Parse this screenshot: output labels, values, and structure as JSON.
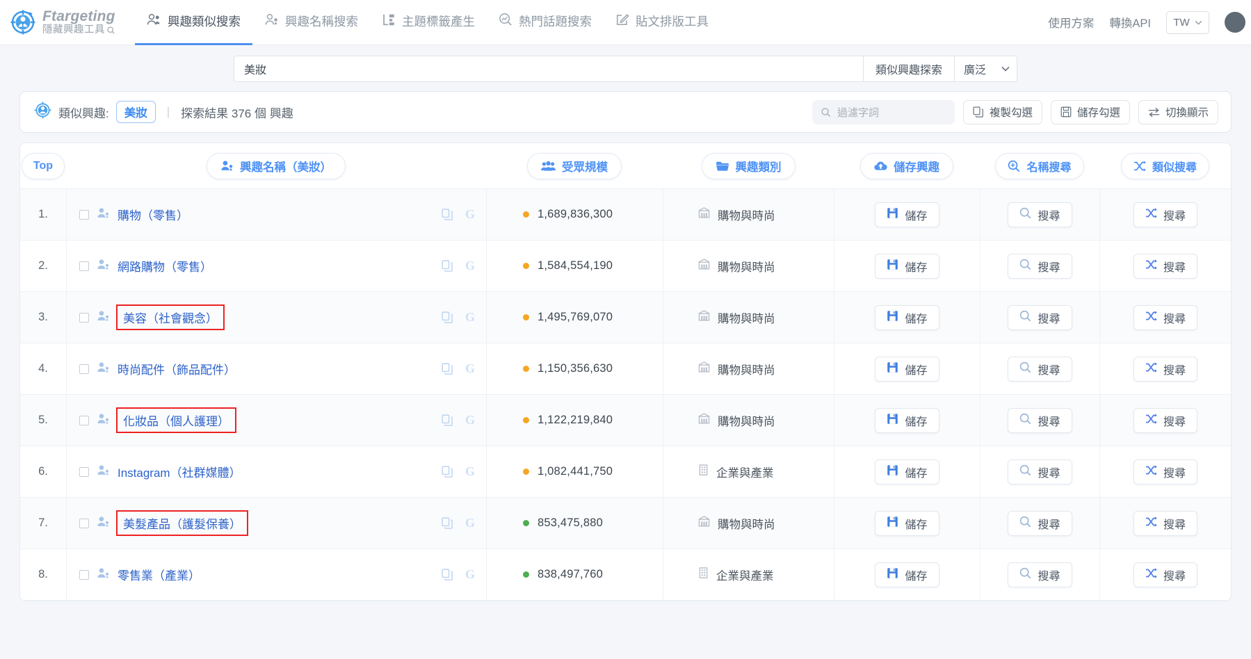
{
  "brand": {
    "name": "Ftargeting",
    "subtitle": "隱藏興趣工具",
    "sub_icon": "magnifier-icon"
  },
  "nav": {
    "items": [
      {
        "label": "興趣類似搜索",
        "icon": "users-search-icon",
        "active": true
      },
      {
        "label": "興趣名稱搜索",
        "icon": "user-tag-icon",
        "active": false
      },
      {
        "label": "主題標籤產生",
        "icon": "hashtag-blocks-icon",
        "active": false
      },
      {
        "label": "熱門話題搜索",
        "icon": "trending-search-icon",
        "active": false
      },
      {
        "label": "貼文排版工具",
        "icon": "edit-square-icon",
        "active": false
      }
    ],
    "right_links": [
      "使用方案",
      "轉換API"
    ],
    "language": "TW"
  },
  "search": {
    "value": "美妝",
    "placeholder": "",
    "button_label": "類似興趣探索",
    "scope_value": "廣泛"
  },
  "infobar": {
    "icon": "target-user-icon",
    "label": "類似興趣:",
    "keyword": "美妝",
    "divider": "|",
    "result_text": "探索結果  376  個 興趣",
    "filter_placeholder": "過濾字詞",
    "filter_icon": "search-icon",
    "buttons": [
      {
        "label": "複製勾選",
        "icon": "copy-icon"
      },
      {
        "label": "儲存勾選",
        "icon": "save-icon"
      },
      {
        "label": "切換顯示",
        "icon": "swap-icon"
      }
    ]
  },
  "table": {
    "headers": {
      "index": "Top",
      "name": "興趣名稱（美妝）",
      "size": "受眾規模",
      "category": "興趣類別",
      "save": "儲存興趣",
      "name_search": "名稱搜尋",
      "similar_search": "類似搜尋"
    },
    "header_icons": {
      "name": "user-tag-icon",
      "size": "users-group-icon",
      "category": "folder-icon",
      "save": "cloud-upload-icon",
      "name_search": "zoom-in-icon",
      "similar_search": "shuffle-icon"
    },
    "row_actions": {
      "save_label": "儲存",
      "save_icon": "floppy-icon",
      "name_search_label": "搜尋",
      "name_search_icon": "magnifier-icon",
      "similar_search_label": "搜尋",
      "similar_search_icon": "shuffle-icon",
      "copy_icon": "copy-icon",
      "google_icon": "google-g-icon"
    },
    "colors": {
      "dot_orange": "#f5a623",
      "dot_green": "#4caf50",
      "highlight_box": "#ee2222",
      "link_blue": "#2c62c9",
      "accent_blue": "#4f93f5"
    },
    "rows": [
      {
        "index": "1.",
        "name": "購物（零售）",
        "highlight": false,
        "size": "1,689,836,300",
        "dot": "orange",
        "category": "購物與時尚",
        "cat_icon": "shop-icon"
      },
      {
        "index": "2.",
        "name": "網路購物（零售）",
        "highlight": false,
        "size": "1,584,554,190",
        "dot": "orange",
        "category": "購物與時尚",
        "cat_icon": "shop-icon"
      },
      {
        "index": "3.",
        "name": "美容（社會觀念）",
        "highlight": true,
        "size": "1,495,769,070",
        "dot": "orange",
        "category": "購物與時尚",
        "cat_icon": "shop-icon"
      },
      {
        "index": "4.",
        "name": "時尚配件（飾品配件）",
        "highlight": false,
        "size": "1,150,356,630",
        "dot": "orange",
        "category": "購物與時尚",
        "cat_icon": "shop-icon"
      },
      {
        "index": "5.",
        "name": "化妝品（個人護理）",
        "highlight": true,
        "size": "1,122,219,840",
        "dot": "orange",
        "category": "購物與時尚",
        "cat_icon": "shop-icon"
      },
      {
        "index": "6.",
        "name": "Instagram（社群媒體）",
        "highlight": false,
        "size": "1,082,441,750",
        "dot": "orange",
        "category": "企業與產業",
        "cat_icon": "building-icon"
      },
      {
        "index": "7.",
        "name": "美髮產品（護髮保養）",
        "highlight": true,
        "size": "853,475,880",
        "dot": "green",
        "category": "購物與時尚",
        "cat_icon": "shop-icon"
      },
      {
        "index": "8.",
        "name": "零售業（產業）",
        "highlight": false,
        "size": "838,497,760",
        "dot": "green",
        "category": "企業與產業",
        "cat_icon": "building-icon"
      }
    ]
  }
}
